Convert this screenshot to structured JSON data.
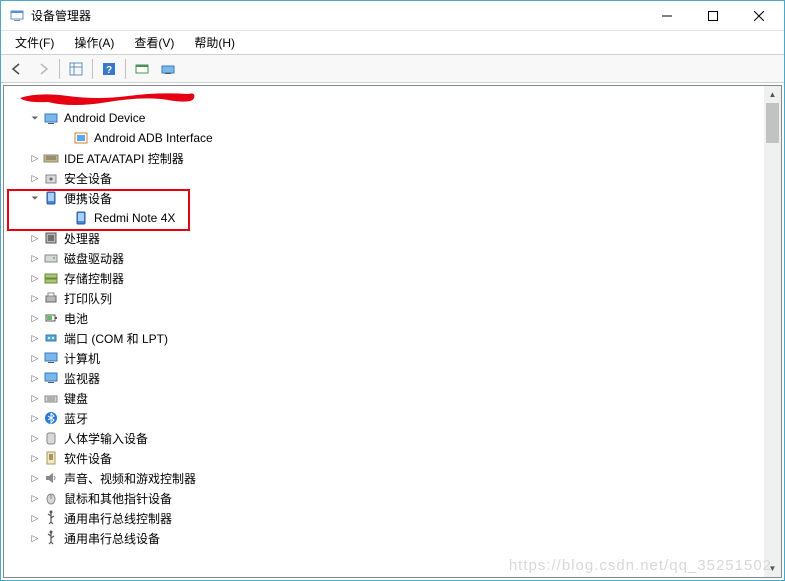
{
  "titlebar": {
    "title": "设备管理器"
  },
  "menu": {
    "file": "文件(F)",
    "action": "操作(A)",
    "view": "查看(V)",
    "help": "帮助(H)"
  },
  "tree": {
    "android_device": "Android Device",
    "android_adb": "Android ADB Interface",
    "ide": "IDE ATA/ATAPI 控制器",
    "security": "安全设备",
    "portable": "便携设备",
    "redmi": "Redmi Note 4X",
    "processor": "处理器",
    "disk": "磁盘驱动器",
    "storage": "存储控制器",
    "print": "打印队列",
    "battery": "电池",
    "ports": "端口 (COM 和 LPT)",
    "computer": "计算机",
    "monitor": "监视器",
    "keyboard": "键盘",
    "bluetooth": "蓝牙",
    "hid": "人体学输入设备",
    "software": "软件设备",
    "sound": "声音、视频和游戏控制器",
    "mouse": "鼠标和其他指针设备",
    "usb_ctrl": "通用串行总线控制器",
    "usb_dev": "通用串行总线设备"
  },
  "watermark": "https://blog.csdn.net/qq_35251502"
}
